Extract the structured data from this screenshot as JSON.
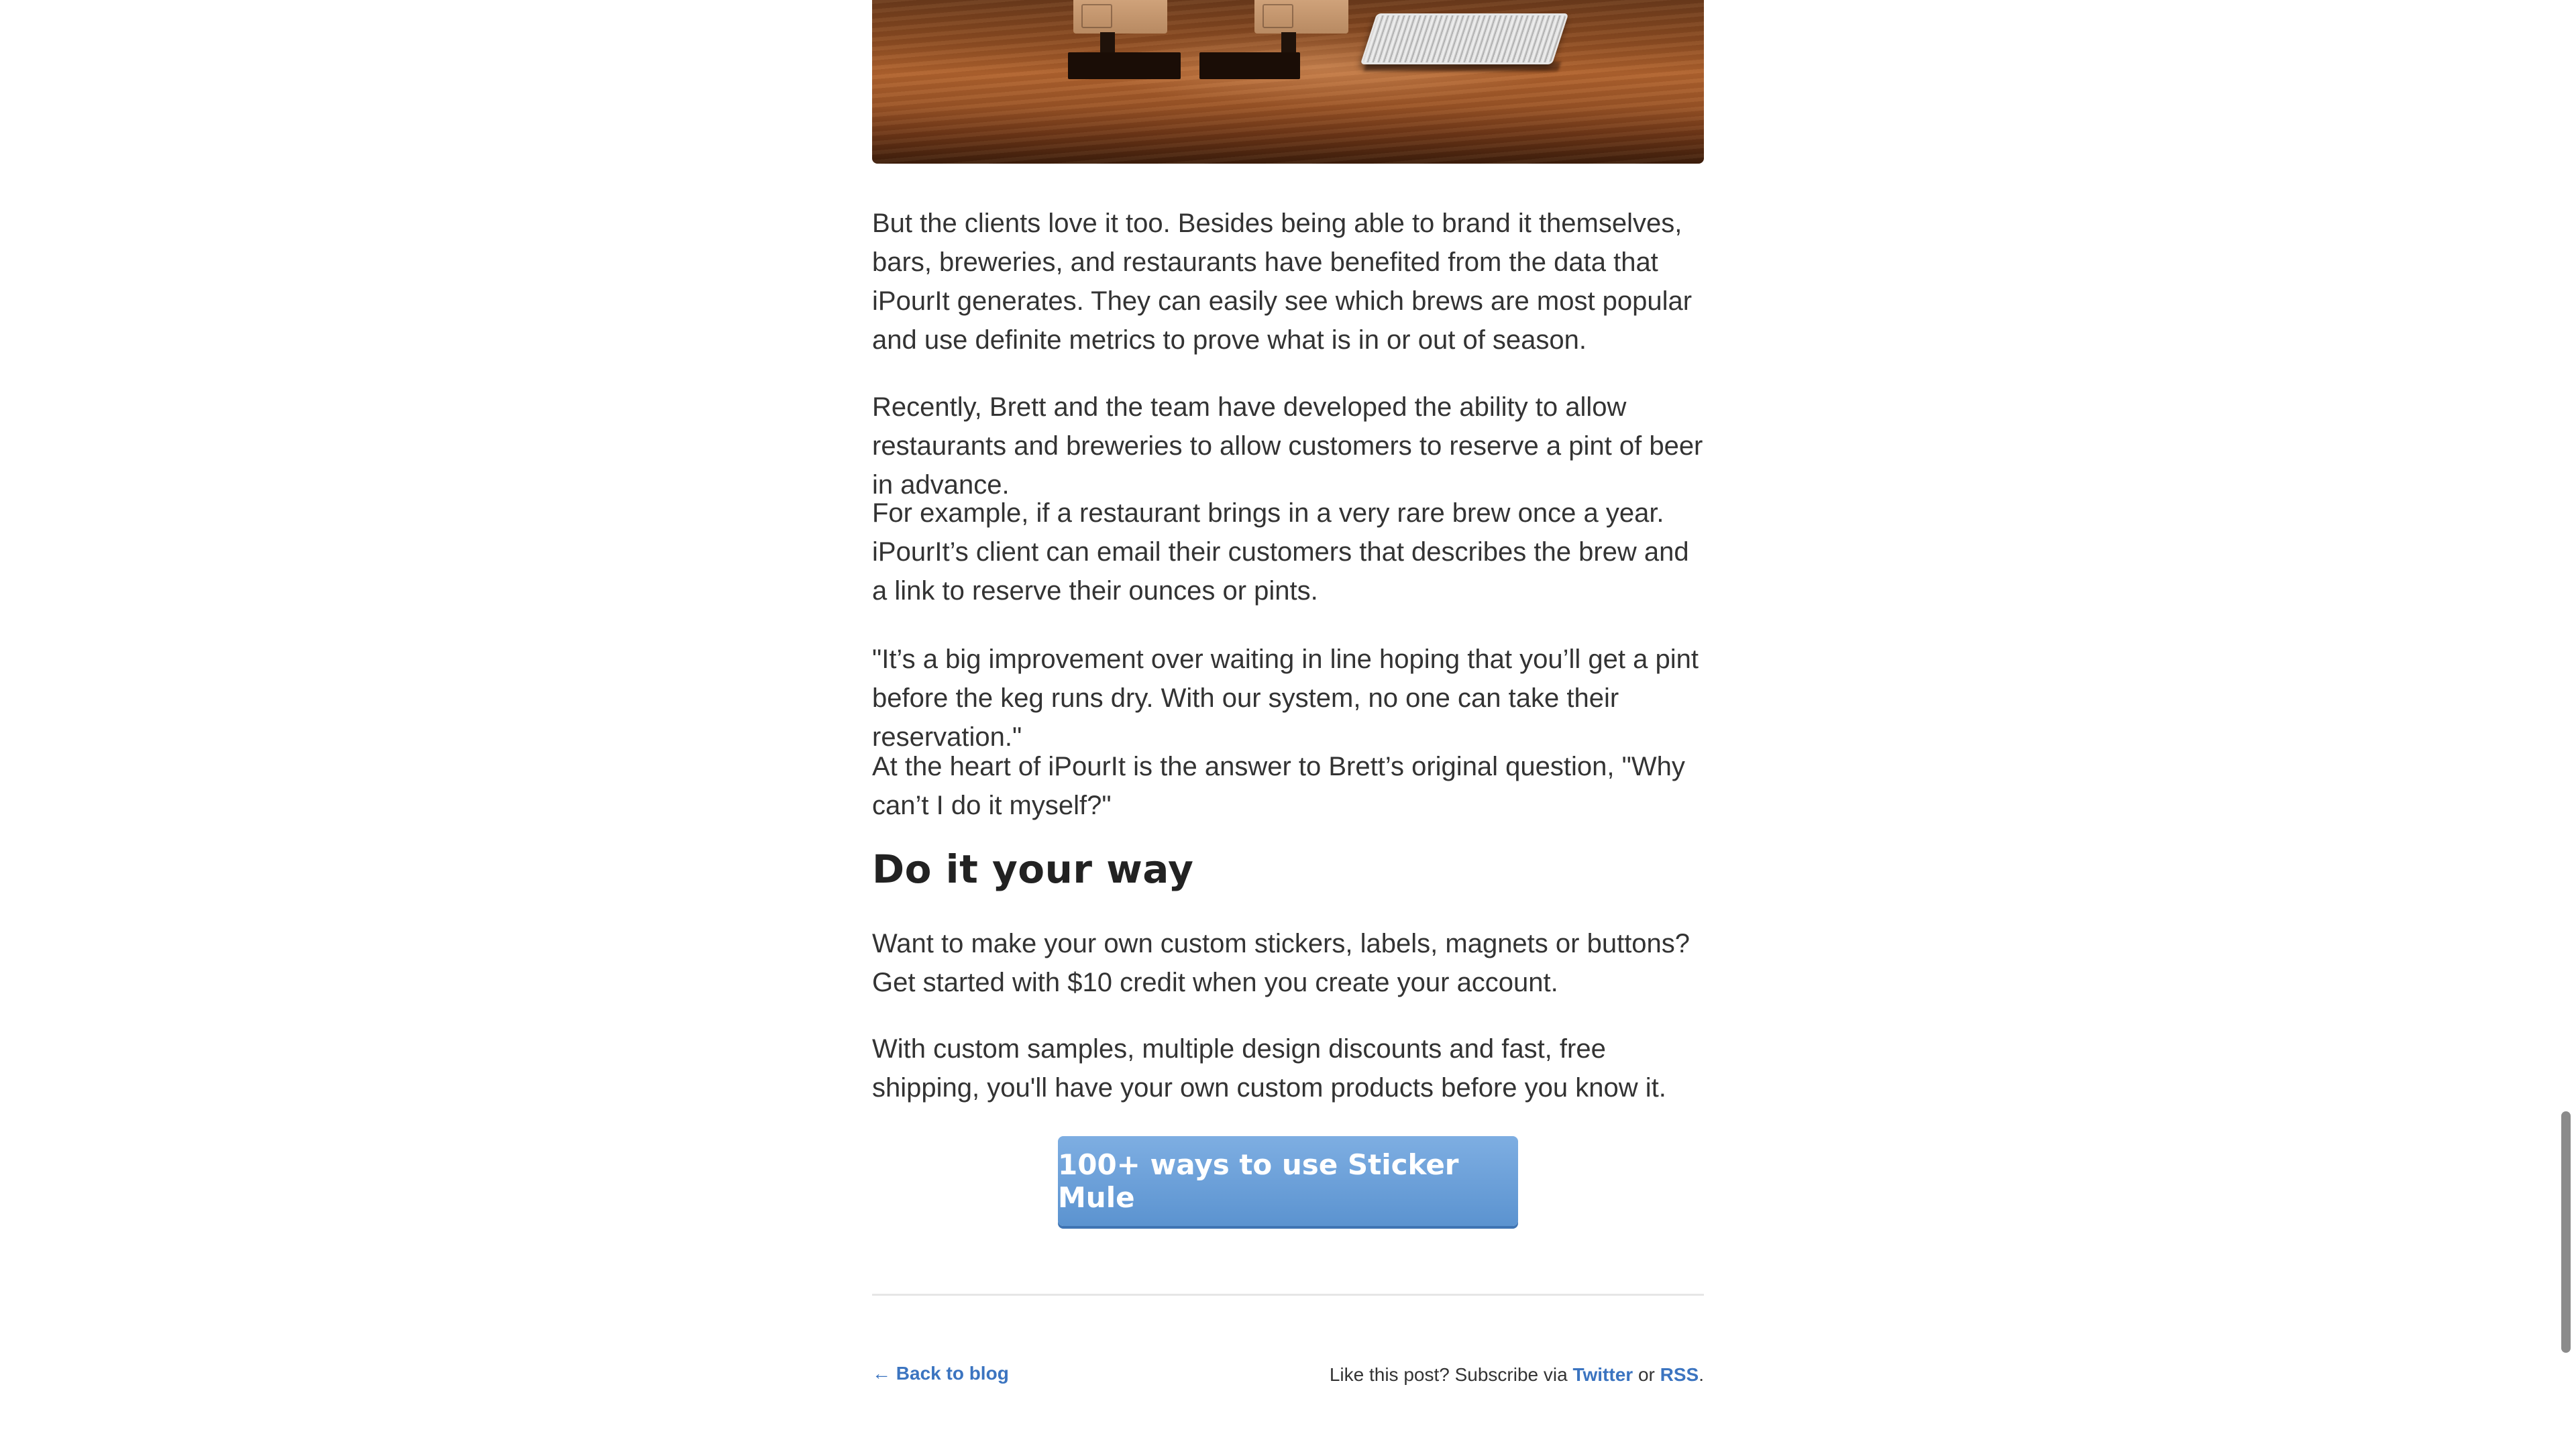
{
  "hero_image": {
    "alt": ""
  },
  "paragraphs": [
    "But the clients love it too. Besides being able to brand it themselves, bars, breweries, and restaurants have benefited from the data that iPourIt generates. They can easily see which brews are most popular and use definite metrics to prove what is in or out of season.",
    "Recently, Brett and the team have developed the ability to allow restaurants and breweries to allow customers to reserve a pint of beer in advance.",
    "For example, if a restaurant brings in a very rare brew once a year. iPourIt’s client can email their customers that describes the brew and a link to reserve their ounces or pints.",
    "\"It’s a big improvement over waiting in line hoping that you’ll get a pint before the keg runs dry. With our system, no one can take their reservation.\"",
    "At the heart of iPourIt is the answer to Brett’s original question, \"Why can’t I do it myself?\""
  ],
  "section": {
    "heading": "Do it your way",
    "paragraphs": [
      "Want to make your own custom stickers, labels, magnets or buttons? Get started with $10 credit when you create your account.",
      "With custom samples, multiple design discounts and fast, free shipping, you'll have your own custom products before you know it."
    ]
  },
  "cta": {
    "label": "100+ ways to use Sticker Mule"
  },
  "footer": {
    "back_arrow": "←",
    "back_label": "Back to blog",
    "subscribe_prefix": "Like this post? Subscribe via",
    "twitter_label": "Twitter",
    "or_text": "or",
    "rss_label": "RSS",
    "period": "."
  },
  "colors": {
    "text": "#333333",
    "link": "#3b74c0",
    "button": "#5b93d0"
  }
}
